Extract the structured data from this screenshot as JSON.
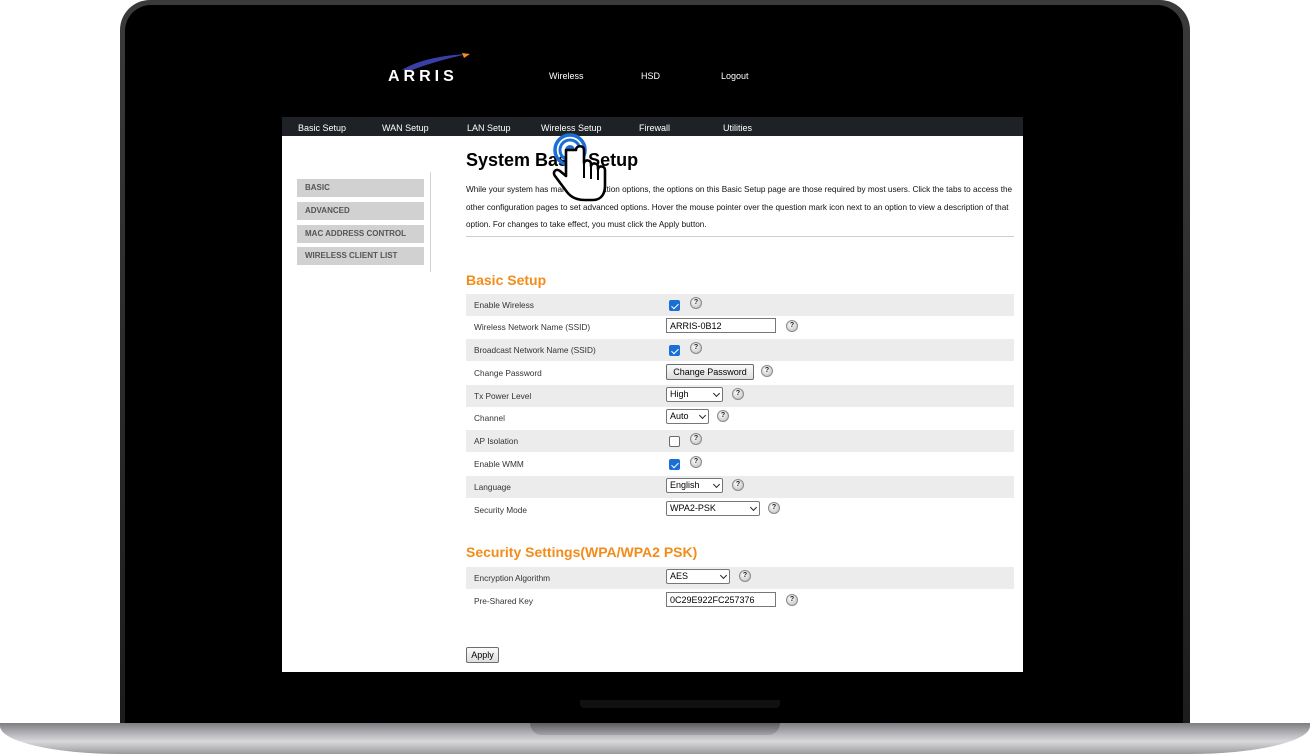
{
  "brand": {
    "logo_text": "ARRIS"
  },
  "topnav": [
    {
      "label": "Wireless"
    },
    {
      "label": "HSD"
    },
    {
      "label": "Logout"
    }
  ],
  "tabs": [
    {
      "label": "Basic Setup"
    },
    {
      "label": "WAN Setup"
    },
    {
      "label": "LAN Setup"
    },
    {
      "label": "Wireless Setup"
    },
    {
      "label": "Firewall"
    },
    {
      "label": "Utilities"
    }
  ],
  "sidebar": {
    "items": [
      {
        "label": "BASIC"
      },
      {
        "label": "ADVANCED"
      },
      {
        "label": "MAC ADDRESS CONTROL"
      },
      {
        "label": "WIRELESS CLIENT LIST"
      }
    ]
  },
  "page": {
    "title": "System Basic Setup",
    "intro": "While your system has many configuration options, the options on this Basic Setup page are those required by most users. Click the tabs to access the other configuration pages to set advanced options. Hover the mouse pointer over the question mark icon next to an option to view a description of that option. For changes to take effect, you must click the Apply button."
  },
  "basic_setup": {
    "title": "Basic Setup",
    "enable_wireless": {
      "label": "Enable Wireless",
      "checked": true
    },
    "ssid": {
      "label": "Wireless Network Name (SSID)",
      "value": "ARRIS-0B12"
    },
    "broadcast_ssid": {
      "label": "Broadcast Network Name (SSID)",
      "checked": true
    },
    "change_password": {
      "label": "Change Password",
      "button": "Change Password"
    },
    "tx_power": {
      "label": "Tx Power Level",
      "value": "High"
    },
    "channel": {
      "label": "Channel",
      "value": "Auto"
    },
    "ap_isolation": {
      "label": "AP Isolation",
      "checked": false
    },
    "enable_wmm": {
      "label": "Enable WMM",
      "checked": true
    },
    "language": {
      "label": "Language",
      "value": "English"
    },
    "security_mode": {
      "label": "Security Mode",
      "value": "WPA2-PSK"
    }
  },
  "security_settings": {
    "title": "Security Settings(WPA/WPA2 PSK)",
    "encryption": {
      "label": "Encryption Algorithm",
      "value": "AES"
    },
    "psk": {
      "label": "Pre-Shared Key",
      "value": "0C29E922FC257376"
    }
  },
  "help_glyph": "?",
  "apply_label": "Apply",
  "colors": {
    "accent": "#f28c1a",
    "tabbar": "#1e2226",
    "checkbox": "#1a6fd6"
  },
  "icons": {
    "help": "question-mark-icon",
    "cursor": "hand-pointer-icon"
  }
}
